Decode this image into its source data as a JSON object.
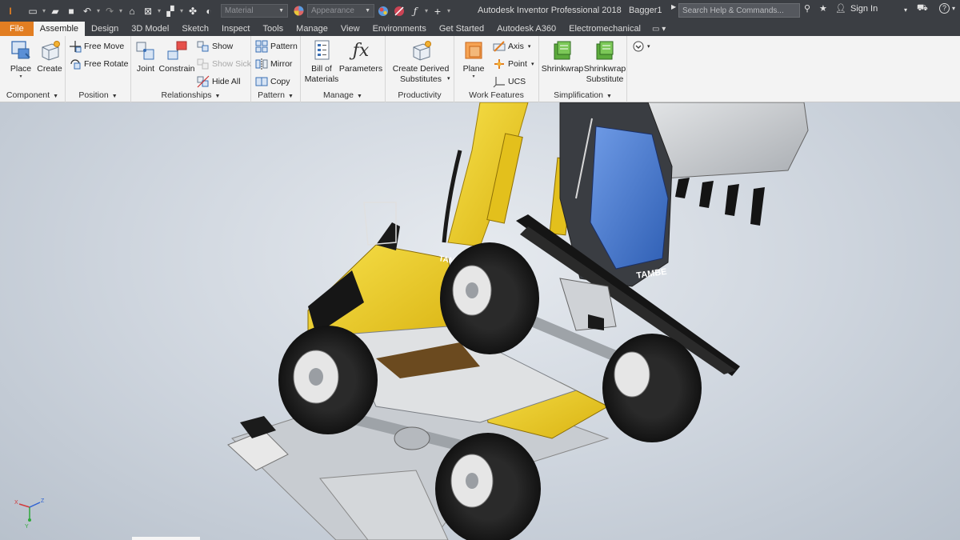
{
  "titlebar": {
    "app_title": "Autodesk Inventor Professional 2018",
    "document_name": "Bagger1",
    "material_dropdown": "Material",
    "appearance_dropdown": "Appearance",
    "search_placeholder": "Search Help & Commands...",
    "sign_in": "Sign In",
    "help_label": "?"
  },
  "tabs": [
    "File",
    "Assemble",
    "Design",
    "3D Model",
    "Sketch",
    "Inspect",
    "Tools",
    "Manage",
    "View",
    "Environments",
    "Get Started",
    "Autodesk A360",
    "Electromechanical"
  ],
  "active_tab": "Assemble",
  "ribbon": {
    "component": {
      "label": "Component",
      "place": "Place",
      "create": "Create"
    },
    "position": {
      "label": "Position",
      "free_move": "Free Move",
      "free_rotate": "Free Rotate"
    },
    "relationships": {
      "label": "Relationships",
      "joint": "Joint",
      "constrain": "Constrain",
      "show": "Show",
      "show_sick": "Show Sick",
      "hide_all": "Hide All"
    },
    "pattern": {
      "label": "Pattern",
      "pattern": "Pattern",
      "mirror": "Mirror",
      "copy": "Copy"
    },
    "manage": {
      "label": "Manage",
      "bom_line1": "Bill of",
      "bom_line2": "Materials",
      "parameters": "Parameters"
    },
    "productivity": {
      "label": "Productivity",
      "line1": "Create Derived",
      "line2": "Substitutes"
    },
    "work_features": {
      "label": "Work Features",
      "plane": "Plane",
      "axis": "Axis",
      "point": "Point",
      "ucs": "UCS"
    },
    "simplification": {
      "label": "Simplification",
      "shrinkwrap": "Shrinkwrap",
      "sub_line1": "Shrinkwrap",
      "sub_line2": "Substitute"
    }
  },
  "viewport": {
    "cab_text_1": "TAMBE",
    "cab_text_2": "TAMBE",
    "triad": {
      "x": "X",
      "y": "Y",
      "z": "Z"
    }
  },
  "colors": {
    "accent_file_tab": "#e27e22",
    "body_yellow": "#f2d21d",
    "glass_blue": "#4f7fd6"
  }
}
